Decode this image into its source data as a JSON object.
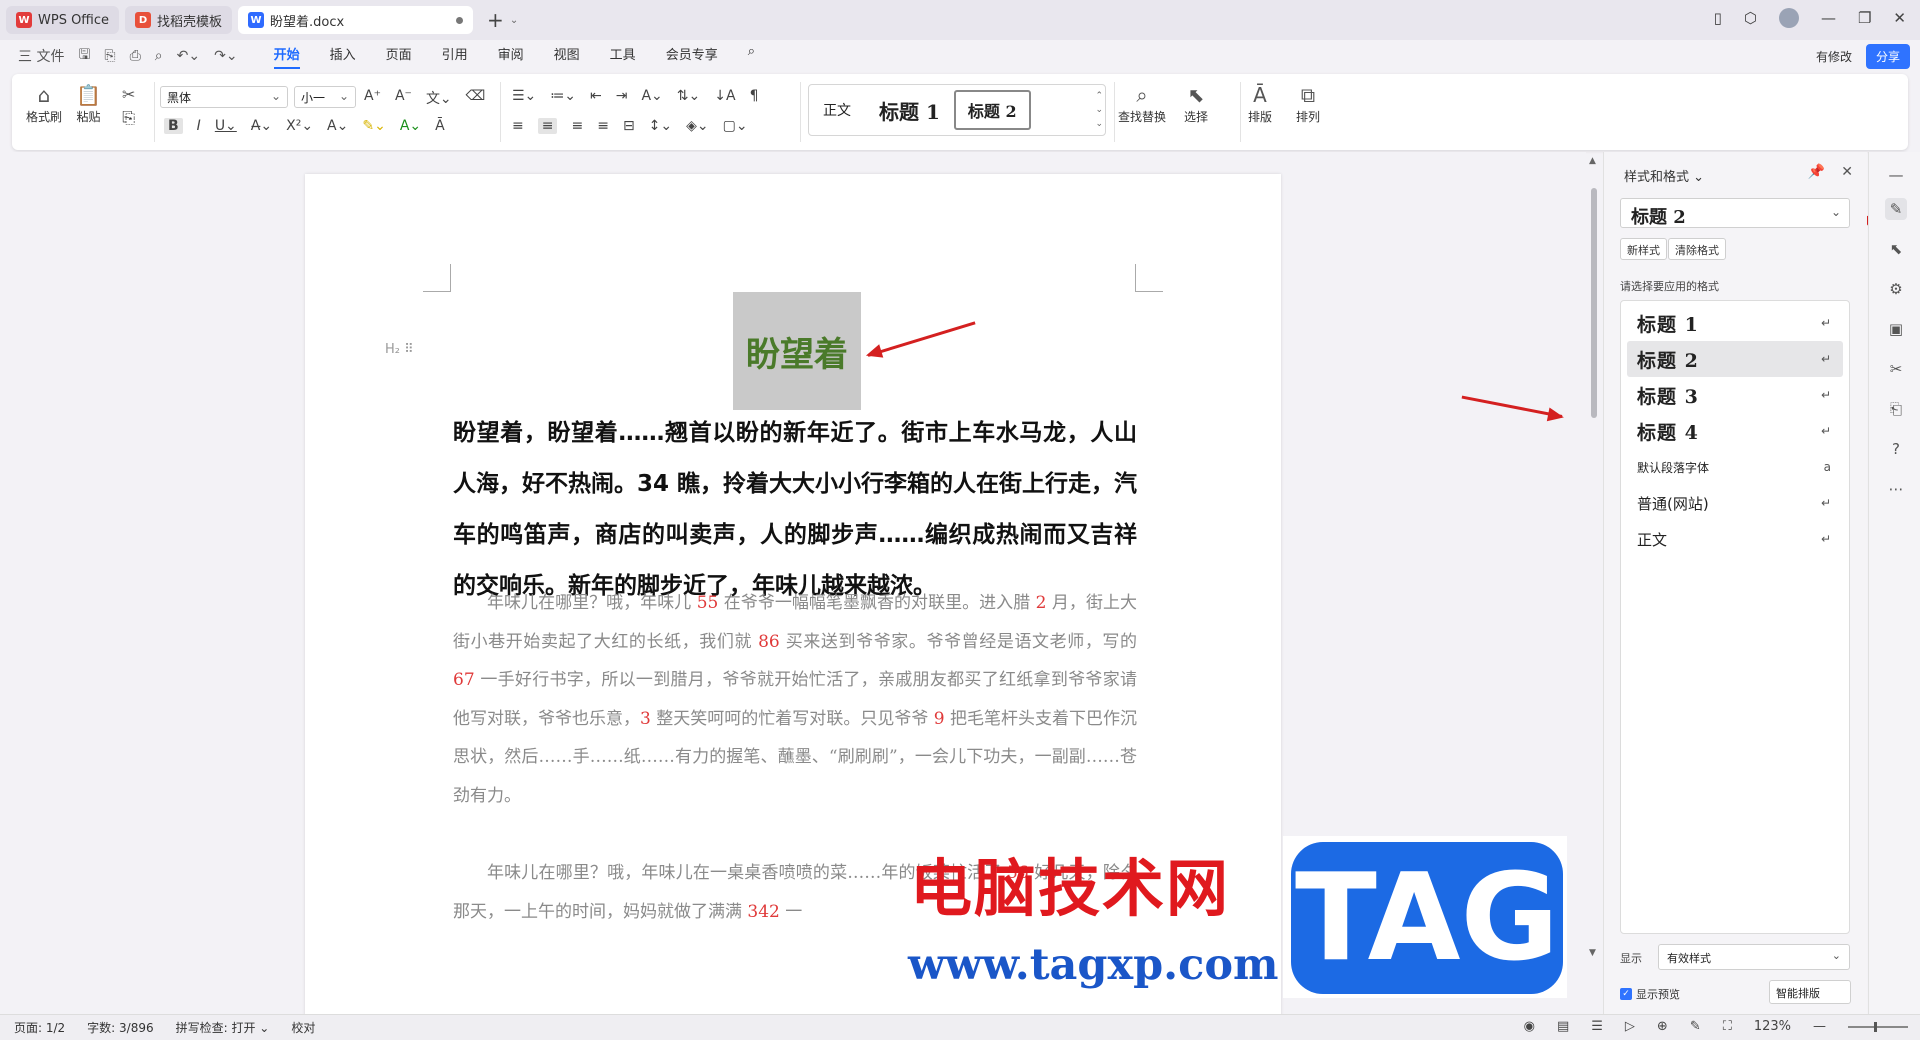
{
  "tabs": [
    {
      "label": "WPS Office",
      "logo": "W",
      "logo_color": "#e23b3b"
    },
    {
      "label": "找稻壳模板",
      "logo": "D",
      "logo_color": "#e8503a"
    },
    {
      "label": "盼望着.docx",
      "logo": "W",
      "logo_color": "#2f6bff"
    }
  ],
  "menu": {
    "file": "三 文件",
    "tabs": [
      "开始",
      "插入",
      "页面",
      "引用",
      "审阅",
      "视图",
      "工具",
      "会员专享"
    ],
    "active_tab": "开始",
    "modified": "有修改",
    "share": "分享"
  },
  "ribbon": {
    "format_painter": "格式刷",
    "paste": "粘贴",
    "font": "黑体",
    "size": "小一",
    "styles": {
      "normal": "正文",
      "h1": "标题 1",
      "h2": "标题 2"
    },
    "find_replace": "查找替换",
    "select": "选择",
    "arrange_layout": "排版",
    "arrange": "排列"
  },
  "document": {
    "heading_marker": "H₂ ⠿",
    "title": "盼望着",
    "bold_paragraph": "盼望着，盼望着……翘首以盼的新年近了。街市上车水马龙，人山人海，好不热闹。34 瞧，拎着大大小小行李箱的人在街上行走，汽车的鸣笛声，商店的叫卖声，人的脚步声……编织成热闹而又吉祥的交响乐。新年的脚步近了，年味儿越来越浓。",
    "para1": [
      {
        "t": "年味儿在哪里？哦，年味儿 "
      },
      {
        "t": "55",
        "n": true
      },
      {
        "t": " 在爷爷一幅幅笔墨飘香的对联里。进入腊 "
      },
      {
        "t": "2",
        "n": true
      },
      {
        "t": " 月，街上大街小巷开始卖起了大红的长纸，我们就 "
      },
      {
        "t": "86",
        "n": true
      },
      {
        "t": " 买来送到爷爷家。爷爷曾经是语文老师，写的 "
      },
      {
        "t": "67",
        "n": true
      },
      {
        "t": " 一手好行书字，所以一到腊月，爷爷就开始忙活了，亲戚朋友都买了红纸拿到爷爷家请他写对联，爷爷也乐意，"
      },
      {
        "t": "3",
        "n": true
      },
      {
        "t": " 整天笑呵呵的忙着写对联。只见爷爷 "
      },
      {
        "t": "9",
        "n": true
      },
      {
        "t": " 把毛笔杆头支着下巴作沉思状，然后……手……纸……有力的握笔、蘸墨、“刷刷刷”，一会儿下功夫，一副副……苍劲有力。"
      }
    ],
    "para2": [
      {
        "t": "年味儿在哪里？哦，年味儿在一桌桌香喷喷的菜……年的饭菜忙活了 "
      },
      {
        "t": "56",
        "n": true
      },
      {
        "t": " 好几天，除夕那天，一上午的时间，妈妈就做了满满 "
      },
      {
        "t": "342",
        "n": true
      },
      {
        "t": " 一"
      }
    ]
  },
  "watermark": {
    "cn": "电脑技术网",
    "url": "www.tagxp.com",
    "tag": "TAG"
  },
  "pane": {
    "title": "样式和格式",
    "current": "标题 2",
    "new_style": "新样式",
    "clear_format": "清除格式",
    "choose_label": "请选择要应用的格式",
    "items": [
      {
        "label": "标题 1",
        "kind": "h",
        "mark": "↵"
      },
      {
        "label": "标题 2",
        "kind": "h",
        "mark": "↵",
        "selected": true
      },
      {
        "label": "标题 3",
        "kind": "h",
        "mark": "↵"
      },
      {
        "label": "标题 4",
        "kind": "h",
        "mark": "↵"
      },
      {
        "label": "默认段落字体",
        "kind": "small",
        "mark": "a"
      },
      {
        "label": "普通(网站)",
        "kind": "mid",
        "mark": "↵"
      },
      {
        "label": "正文",
        "kind": "mid",
        "mark": "↵"
      }
    ],
    "show_label": "显示",
    "show_value": "有效样式",
    "preview": "显示预览",
    "smart": "智能排版"
  },
  "status": {
    "page": "页面: 1/2",
    "words": "字数: 3/896",
    "spell": "拼写检查: 打开 ⌄",
    "proof": "校对",
    "zoom": "123%"
  }
}
